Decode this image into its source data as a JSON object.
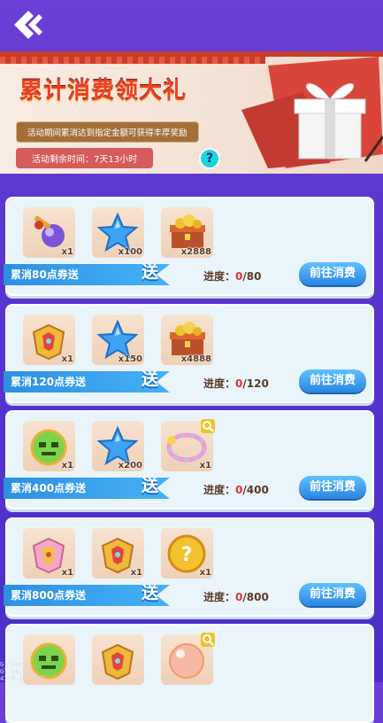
{
  "header": {
    "back_icon": "double-chevron-left-icon"
  },
  "banner": {
    "title": "累计消费领大礼",
    "subtitle": "活动期间累消达到指定金额可获得丰厚奖励",
    "timer": "活动剩余时间：7天13小时",
    "help": "?",
    "gift_icon": "gift-box-icon"
  },
  "colors": {
    "accent_red": "#e3322d",
    "button_blue": "#2a86e0",
    "ribbon_blue": "#45b2f7"
  },
  "tiers": [
    {
      "ribbon": "累消80点券送",
      "send": "送",
      "progress_label": "进度：",
      "progress_current": "0",
      "progress_total": "/80",
      "button": "前往消费",
      "items": [
        {
          "icon": "weapon-orb-icon",
          "qty": "x1"
        },
        {
          "icon": "blue-star-icon",
          "qty": "x100"
        },
        {
          "icon": "gold-chest-icon",
          "qty": "x2888"
        }
      ]
    },
    {
      "ribbon": "累消120点券送",
      "send": "送",
      "progress_label": "进度：",
      "progress_current": "0",
      "progress_total": "/120",
      "button": "前往消费",
      "items": [
        {
          "icon": "golden-armor-icon",
          "qty": "x1"
        },
        {
          "icon": "blue-star-icon",
          "qty": "x150"
        },
        {
          "icon": "gold-chest-icon",
          "qty": "x4888"
        }
      ]
    },
    {
      "ribbon": "累消400点券送",
      "send": "送",
      "progress_label": "进度：",
      "progress_current": "0",
      "progress_total": "/400",
      "button": "前往消费",
      "items": [
        {
          "icon": "green-pet-icon",
          "qty": "x1"
        },
        {
          "icon": "blue-star-icon",
          "qty": "x200"
        },
        {
          "icon": "rainbow-bracelet-icon",
          "qty": "x1"
        }
      ]
    },
    {
      "ribbon": "累消800点券送",
      "send": "送",
      "progress_label": "进度：",
      "progress_current": "0",
      "progress_total": "/800",
      "button": "前往消费",
      "items": [
        {
          "icon": "pink-armor-icon",
          "qty": "x1"
        },
        {
          "icon": "golden-armor-icon",
          "qty": "x1"
        },
        {
          "icon": "mystery-coin-icon",
          "qty": "x1"
        }
      ]
    },
    {
      "items": [
        {
          "icon": "green-pet-icon",
          "qty": ""
        },
        {
          "icon": "golden-armor-icon",
          "qty": ""
        },
        {
          "icon": "bubble-orb-icon",
          "qty": ""
        }
      ]
    }
  ],
  "debug_text": [
    "G- vers...",
    "Gl ca...",
    "47.9 / 0.021"
  ]
}
